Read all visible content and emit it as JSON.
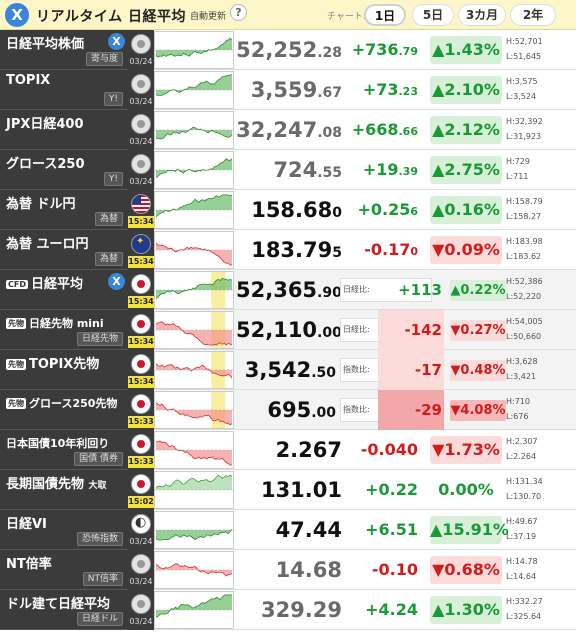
{
  "header": {
    "title": "リアルタイム 日経平均",
    "auto_update": "自動更新",
    "help": "?",
    "chart_label": "チャート:",
    "periods": [
      "1日",
      "5日",
      "3カ月",
      "2年"
    ],
    "active_period": "1日"
  },
  "rows": [
    {
      "name": "日経平均株価",
      "sub": "寄与度",
      "date": "03/24",
      "price_int": "52,252",
      "price_dec": ".28",
      "change_int": "+736",
      "change_dec": ".79",
      "pct": "▲1.43%",
      "high": "H:52,701",
      "low": "L:51,645",
      "dir": "pos",
      "flag": "gray",
      "x": true
    },
    {
      "name": "TOPIX",
      "sub": "Y!",
      "date": "03/24",
      "price_int": "3,559",
      "price_dec": ".67",
      "change_int": "+73",
      "change_dec": ".23",
      "pct": "▲2.10%",
      "high": "H:3,575",
      "low": "L:3,524",
      "dir": "pos",
      "flag": "gray"
    },
    {
      "name": "JPX日経400",
      "sub": "",
      "date": "03/24",
      "price_int": "32,247",
      "price_dec": ".08",
      "change_int": "+668",
      "change_dec": ".66",
      "pct": "▲2.12%",
      "high": "H:32,392",
      "low": "L:31,923",
      "dir": "pos",
      "flag": "gray"
    },
    {
      "name": "グロース250",
      "sub": "Y!",
      "date": "03/24",
      "price_int": "724",
      "price_dec": ".55",
      "change_int": "+19",
      "change_dec": ".39",
      "pct": "▲2.75%",
      "high": "H:729",
      "low": "L:711",
      "dir": "pos",
      "flag": "gray"
    },
    {
      "name": "為替 ドル円",
      "sub": "為替",
      "date": "15:34",
      "price_int": "158.68",
      "price_dec": "0",
      "change_int": "+0.25",
      "change_dec": "6",
      "pct": "▲0.16%",
      "high": "H:158.79",
      "low": "L:158.27",
      "dir": "pos",
      "flag": "us",
      "dark": true
    },
    {
      "name": "為替 ユーロ円",
      "sub": "為替",
      "date": "15:34",
      "price_int": "183.79",
      "price_dec": "5",
      "change_int": "-0.17",
      "change_dec": "0",
      "pct": "▼0.09%",
      "high": "H:183.98",
      "low": "L:183.62",
      "dir": "neg",
      "flag": "eu",
      "dark": true
    }
  ],
  "futures": [
    {
      "tag": "CFD",
      "name": "日経平均",
      "sub": "",
      "date": "15:34",
      "price_int": "52,365",
      "price_dec": ".90",
      "basis": "日経比:",
      "diff": "+113",
      "pct": "▲0.22%",
      "high": "H:52,386",
      "low": "L:52,220",
      "dir": "pos",
      "x": true
    },
    {
      "tag": "先物",
      "name": "日経先物 mini",
      "sub": "日経先物",
      "date": "15:34",
      "price_int": "52,110",
      "price_dec": ".00",
      "basis": "日経比:",
      "diff": "-142",
      "pct": "▼0.27%",
      "high": "H:54,005",
      "low": "L:50,660",
      "dir": "neg"
    },
    {
      "tag": "先物",
      "name": "TOPIX先物",
      "sub": "",
      "date": "15:34",
      "price_int": "3,542",
      "price_dec": ".50",
      "basis": "指数比:",
      "diff": "-17",
      "pct": "▼0.48%",
      "high": "H:3,628",
      "low": "L:3,421",
      "dir": "neg"
    },
    {
      "tag": "先物",
      "name": "グロース250先物",
      "sub": "",
      "date": "15:33",
      "price_int": "695",
      "price_dec": ".00",
      "basis": "指数比:",
      "diff": "-29",
      "pct": "▼4.08%",
      "high": "H:710",
      "low": "L:676",
      "dir": "negstrong"
    }
  ],
  "bonds": [
    {
      "name": "日本国債10年利回り",
      "sub": "国債 債券",
      "date": "15:33",
      "price": "2.267",
      "change": "-0.040",
      "pct": "▼1.73%",
      "high": "H:2.307",
      "low": "L:2.264",
      "dir": "neg",
      "flag": "jp"
    },
    {
      "name": "長期国債先物",
      "small": "大取",
      "sub": "",
      "date": "15:02",
      "price": "131.01",
      "change": "+0.22",
      "pct": "0.00%",
      "high": "H:131.34",
      "low": "L:130.70",
      "dir": "zero",
      "flag": "jp"
    },
    {
      "name": "日経VI",
      "sub": "恐怖指数",
      "date": "03/24",
      "price": "47.44",
      "change": "+6.51",
      "pct": "▲15.91%",
      "high": "H:49.67",
      "low": "L:37.19",
      "dir": "pos",
      "flag": "vi"
    },
    {
      "name": "NT倍率",
      "sub": "NT倍率",
      "date": "03/24",
      "price": "14.68",
      "change": "-0.10",
      "pct": "▼0.68%",
      "high": "H:14.78",
      "low": "L:14.64",
      "dir": "neg",
      "flag": "gray",
      "grayprice": true
    },
    {
      "name": "ドル建て日経平均",
      "sub": "日経ドル",
      "date": "03/24",
      "price": "329.29",
      "change": "+4.24",
      "pct": "▲1.30%",
      "high": "H:332.27",
      "low": "L:325.64",
      "dir": "pos",
      "flag": "gray",
      "grayprice": true
    }
  ]
}
